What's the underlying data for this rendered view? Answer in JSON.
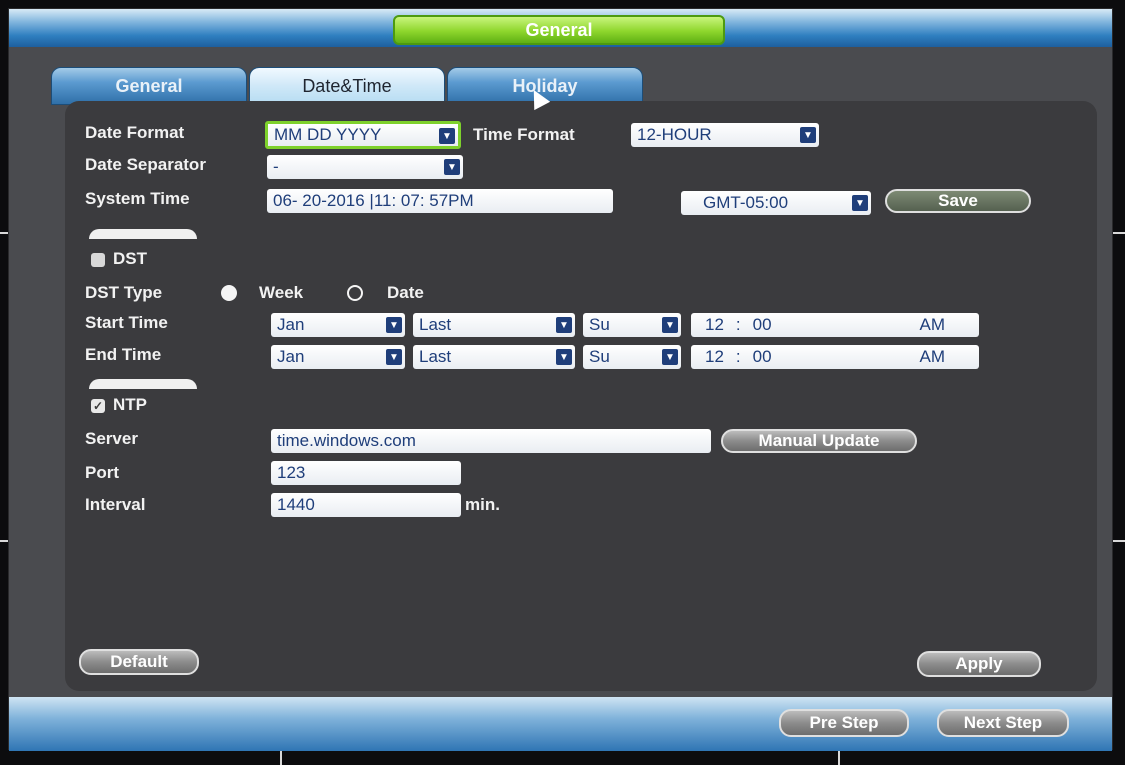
{
  "window": {
    "title": "General"
  },
  "tabs": [
    {
      "label": "General",
      "active": false
    },
    {
      "label": "Date&Time",
      "active": true
    },
    {
      "label": "Holiday",
      "active": false
    }
  ],
  "date_format": {
    "label": "Date Format",
    "value": "MM DD YYYY"
  },
  "time_format": {
    "label": "Time Format",
    "value": "12-HOUR"
  },
  "date_separator": {
    "label": "Date Separator",
    "value": "-"
  },
  "system_time": {
    "label": "System Time",
    "value": "06- 20-2016 |11: 07: 57PM",
    "timezone": "GMT-05:00",
    "save_label": "Save"
  },
  "dst": {
    "label": "DST",
    "checked": false
  },
  "dst_type": {
    "label": "DST Type",
    "week_label": "Week",
    "date_label": "Date",
    "selected": "Week"
  },
  "start_time": {
    "label": "Start Time",
    "month": "Jan",
    "week": "Last",
    "day": "Su",
    "hour": "12",
    "sep": ":",
    "minute": "00",
    "ampm": "AM"
  },
  "end_time": {
    "label": "End Time",
    "month": "Jan",
    "week": "Last",
    "day": "Su",
    "hour": "12",
    "sep": ":",
    "minute": "00",
    "ampm": "AM"
  },
  "ntp": {
    "label": "NTP",
    "checked": true
  },
  "server": {
    "label": "Server",
    "value": "time.windows.com",
    "manual_update_label": "Manual Update"
  },
  "port": {
    "label": "Port",
    "value": "123"
  },
  "interval": {
    "label": "Interval",
    "value": "1440",
    "unit": "min."
  },
  "buttons": {
    "default": "Default",
    "apply": "Apply",
    "pre_step": "Pre Step",
    "next_step": "Next Step"
  },
  "colors": {
    "title_green": "#8ed62c",
    "tab_blue": "#5b9ad0",
    "panel": "#3b3b3e",
    "field_text": "#1f3e7a"
  }
}
